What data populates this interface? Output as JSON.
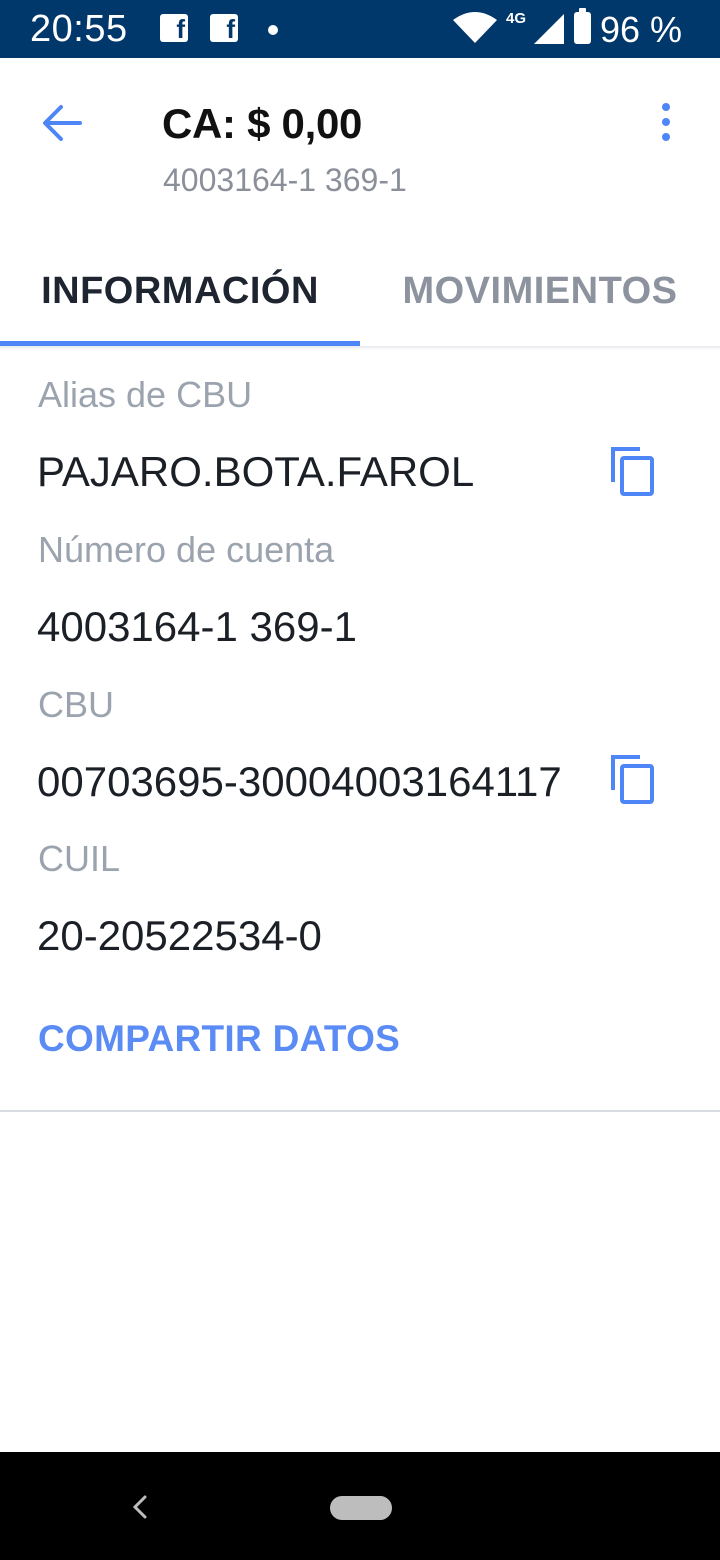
{
  "status_bar": {
    "time": "20:55",
    "network_type": "4G",
    "battery": "96 %",
    "icons": [
      "facebook-icon",
      "facebook-icon",
      "notification-dot",
      "wifi-icon",
      "signal-icon",
      "battery-icon"
    ]
  },
  "header": {
    "title": "CA: $ 0,00",
    "subtitle": "4003164-1 369-1",
    "back_icon": "arrow-left-icon",
    "menu_icon": "more-vertical-icon"
  },
  "tabs": [
    {
      "label": "INFORMACIÓN",
      "active": true
    },
    {
      "label": "MOVIMIENTOS",
      "active": false
    }
  ],
  "fields": [
    {
      "label": "Alias de CBU",
      "value": "PAJARO.BOTA.FAROL",
      "copyable": true
    },
    {
      "label": "Número de cuenta",
      "value": "4003164-1 369-1",
      "copyable": false
    },
    {
      "label": "CBU",
      "value": "00703695-30004003164117",
      "copyable": true
    },
    {
      "label": "CUIL",
      "value": "20-20522534-0",
      "copyable": false
    }
  ],
  "share_button": "COMPARTIR DATOS",
  "colors": {
    "status_bar": "#01386c",
    "accent": "#4f86f7",
    "text_primary": "#1b1f26",
    "text_secondary": "#9ba3ae"
  }
}
